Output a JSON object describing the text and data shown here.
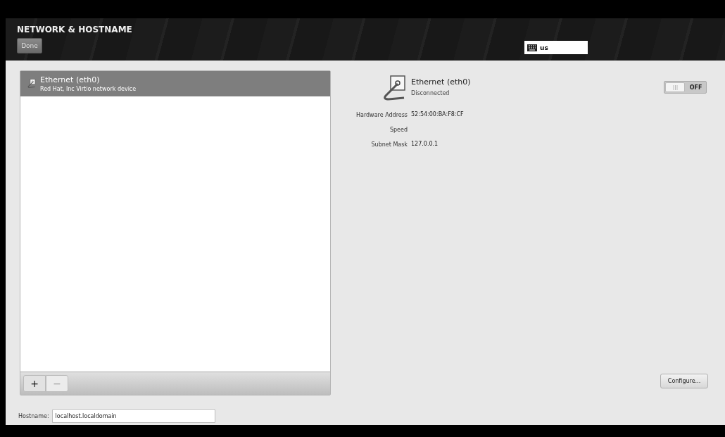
{
  "header": {
    "title": "NETWORK & HOSTNAME",
    "done_button": "Done",
    "keyboard_layout": "us"
  },
  "devices": [
    {
      "name": "Ethernet (eth0)",
      "description": "Red Hat, Inc Virtio network device",
      "selected": true
    }
  ],
  "list_toolbar": {
    "add": "+",
    "remove": "−"
  },
  "detail": {
    "name": "Ethernet (eth0)",
    "status": "Disconnected",
    "switch": {
      "on": false,
      "label": "OFF"
    },
    "properties": [
      {
        "label": "Hardware Address",
        "value": "52:54:00:BA:F8:CF"
      },
      {
        "label": "Speed"
      },
      {
        "label": "Subnet Mask",
        "value": "127.0.0.1"
      }
    ],
    "configure_button": "Configure..."
  },
  "hostname": {
    "label": "Hostname:",
    "value": "localhost.localdomain"
  }
}
